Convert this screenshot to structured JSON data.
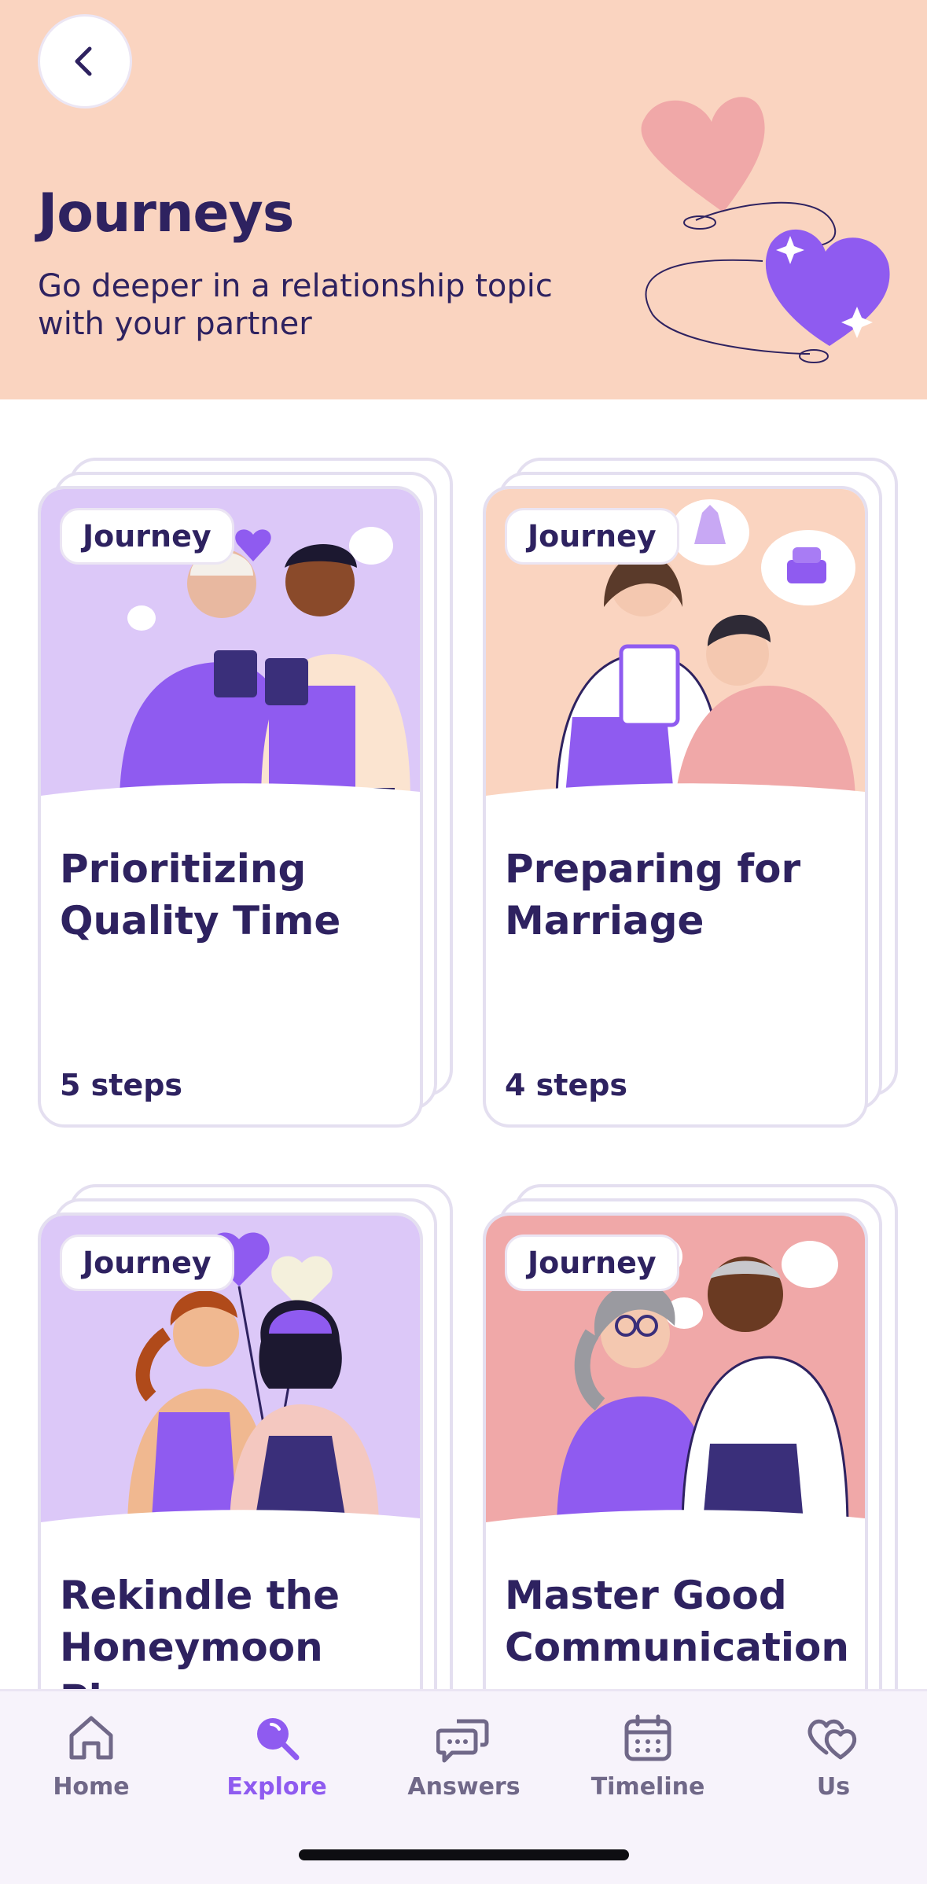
{
  "header": {
    "title": "Journeys",
    "subtitle": "Go deeper in a relationship topic with your partner"
  },
  "cards": [
    {
      "badge": "Journey",
      "title": "Prioritizing Quality Time",
      "steps": "5 steps",
      "bg": "#dcc8f8"
    },
    {
      "badge": "Journey",
      "title": "Preparing for Marriage",
      "steps": "4 steps",
      "bg": "#fad4c0"
    },
    {
      "badge": "Journey",
      "title": "Rekindle the Honeymoon Phase",
      "steps": "",
      "bg": "#dcc8f8"
    },
    {
      "badge": "Journey",
      "title": "Master Good Communication",
      "steps": "",
      "bg": "#f0a8a8"
    }
  ],
  "tabs": [
    {
      "label": "Home",
      "icon": "home-icon",
      "active": false
    },
    {
      "label": "Explore",
      "icon": "explore-icon",
      "active": true
    },
    {
      "label": "Answers",
      "icon": "chat-bubbles-icon",
      "active": false
    },
    {
      "label": "Timeline",
      "icon": "calendar-icon",
      "active": false
    },
    {
      "label": "Us",
      "icon": "hearts-icon",
      "active": false
    }
  ],
  "colors": {
    "header_bg": "#fad4c0",
    "primary_text": "#2e2260",
    "accent_purple": "#8f5bf0",
    "tab_inactive": "#706888"
  }
}
